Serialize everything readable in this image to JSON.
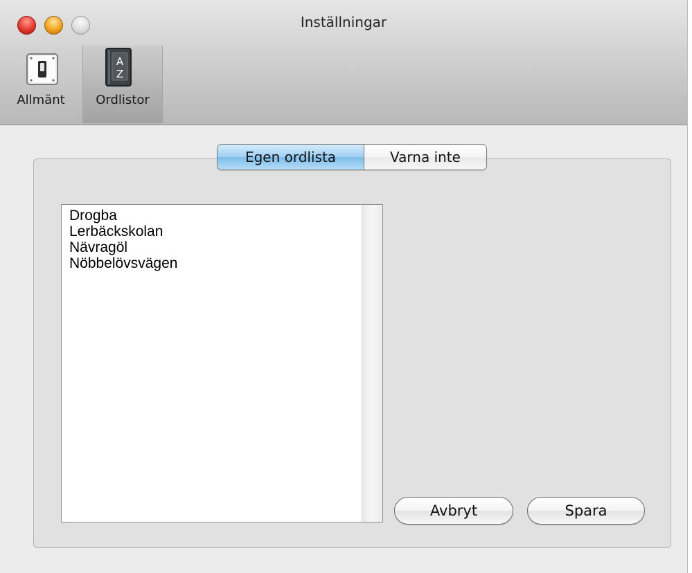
{
  "window": {
    "title": "Inställningar"
  },
  "toolbar": {
    "items": [
      {
        "label": "Allmänt",
        "icon": "switch-icon",
        "selected": false
      },
      {
        "label": "Ordlistor",
        "icon": "dictionary-book-icon",
        "selected": true
      }
    ],
    "book_letters": {
      "top": "A",
      "bottom": "Z"
    }
  },
  "tabs": [
    {
      "label": "Egen ordlista",
      "active": true
    },
    {
      "label": "Varna inte",
      "active": false
    }
  ],
  "word_list": {
    "items": [
      "Drogba",
      "Lerbäckskolan",
      "Nävragöl",
      "Nöbbelövsvägen"
    ]
  },
  "buttons": {
    "cancel_label": "Avbryt",
    "save_label": "Spara"
  },
  "colors": {
    "close": "#e33b2e",
    "minimize": "#f3a31e",
    "zoom": "#dcdcdc",
    "tab_active": "#9fcff3"
  }
}
